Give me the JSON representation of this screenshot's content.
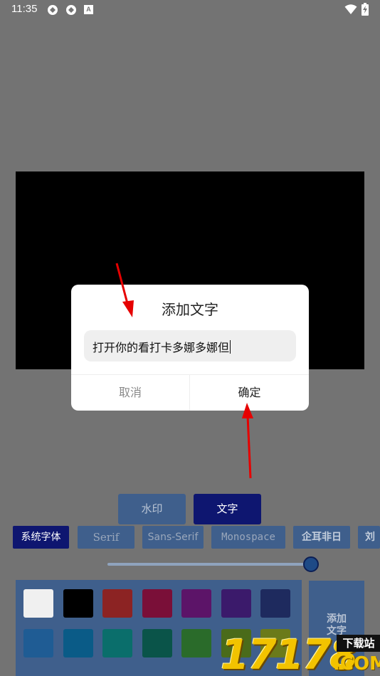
{
  "status_bar": {
    "time": "11:35",
    "icons": [
      "sync-icon",
      "sync-icon",
      "a-icon",
      "wifi-icon",
      "battery-icon"
    ],
    "a_glyph": "A"
  },
  "dialog": {
    "title": "添加文字",
    "input_value": "打开你的看打卡多娜多娜但",
    "cancel_label": "取消",
    "confirm_label": "确定"
  },
  "mode_tabs": [
    {
      "label": "水印",
      "active": false
    },
    {
      "label": "文字",
      "active": true
    }
  ],
  "font_options": [
    {
      "label": "系统字体",
      "active": true
    },
    {
      "label": "Serif",
      "active": false
    },
    {
      "label": "Sans-Serif",
      "active": false
    },
    {
      "label": "Monospace",
      "active": false
    },
    {
      "label": "企耳非日",
      "active": false
    },
    {
      "label": "刘",
      "active": false
    }
  ],
  "slider": {
    "value_fraction": 0.97
  },
  "palette": {
    "colors_row1": [
      "#f0f0f0",
      "#000000",
      "#8c2323",
      "#7a0f38",
      "#5c1468",
      "#3b1a6b",
      "#1e2a5e"
    ],
    "colors_row2": [
      "#1f5c94",
      "#0a5b87",
      "#0a6e6b",
      "#0a5449",
      "#2a6b2a",
      "#4a6b1a",
      "#6b7a1a"
    ]
  },
  "add_text_button": {
    "line1": "添加",
    "line2": "文字"
  },
  "watermark": {
    "number": "17178",
    "site": "下载站",
    "domain": ".COM"
  },
  "colors": {
    "accent": "#0e1670",
    "button_bg": "#3f5f8c",
    "annotation_arrow": "#e60000"
  }
}
